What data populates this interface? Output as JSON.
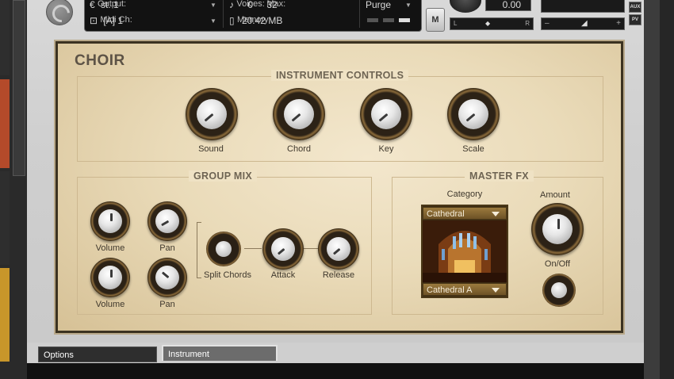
{
  "header": {
    "output_label": "Output:",
    "output_value": "st. 1",
    "midi_label": "Midi Ch:",
    "midi_value": "[A] 1",
    "voices_label": "Voices:",
    "voices_value": "0",
    "max_label": "Max:",
    "max_value": "32",
    "memory_label": "Memory:",
    "memory_value": "20.42 MB",
    "purge_label": "Purge",
    "m_button": "M",
    "tune_value": "0.00",
    "pan_left": "L",
    "pan_right": "R",
    "vol_minus": "–",
    "vol_plus": "+",
    "aux_label": "AUX",
    "pv_label": "PV"
  },
  "instrument": {
    "title": "CHOIR",
    "controls_title": "INSTRUMENT CONTROLS",
    "knobs": [
      "Sound",
      "Chord",
      "Key",
      "Scale"
    ],
    "group_mix": {
      "title": "GROUP MIX",
      "volume1": "Volume",
      "pan1": "Pan",
      "volume2": "Volume",
      "pan2": "Pan",
      "split": "Split Chords",
      "attack": "Attack",
      "release": "Release"
    },
    "master_fx": {
      "title": "MASTER FX",
      "category_label": "Category",
      "category_value": "Cathedral",
      "preset_value": "Cathedral A",
      "amount_label": "Amount",
      "onoff_label": "On/Off"
    }
  },
  "tabs": {
    "options": "Options",
    "instrument": "Instrument"
  }
}
